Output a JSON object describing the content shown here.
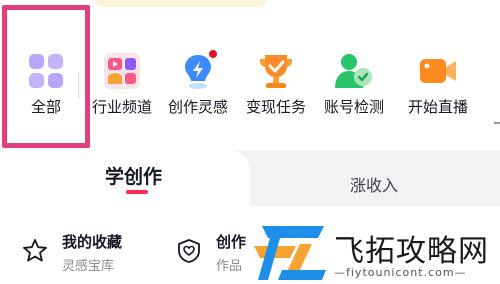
{
  "shortcuts": [
    {
      "label": "全部",
      "icon": "grid-apps-icon"
    },
    {
      "label": "行业频道",
      "icon": "channel-icon"
    },
    {
      "label": "创作灵感",
      "icon": "bulb-icon",
      "badge": true
    },
    {
      "label": "变现任务",
      "icon": "trophy-icon"
    },
    {
      "label": "账号检测",
      "icon": "user-check-icon"
    },
    {
      "label": "开始直播",
      "icon": "camera-icon"
    }
  ],
  "tabs": [
    {
      "label": "学创作",
      "active": true
    },
    {
      "label": "涨收入",
      "active": false
    }
  ],
  "cards": [
    {
      "title": "我的收藏",
      "subtitle": "灵感宝库",
      "icon": "star-icon"
    },
    {
      "title": "创作",
      "subtitle": "作品",
      "icon": "shield-heart-icon"
    }
  ],
  "watermark": {
    "title": "飞拓攻略网",
    "url": "—fiytounicont.com—"
  },
  "colors": {
    "accent": "#fe2c55",
    "highlight": "#e0407f",
    "badge": "#e0152d"
  }
}
